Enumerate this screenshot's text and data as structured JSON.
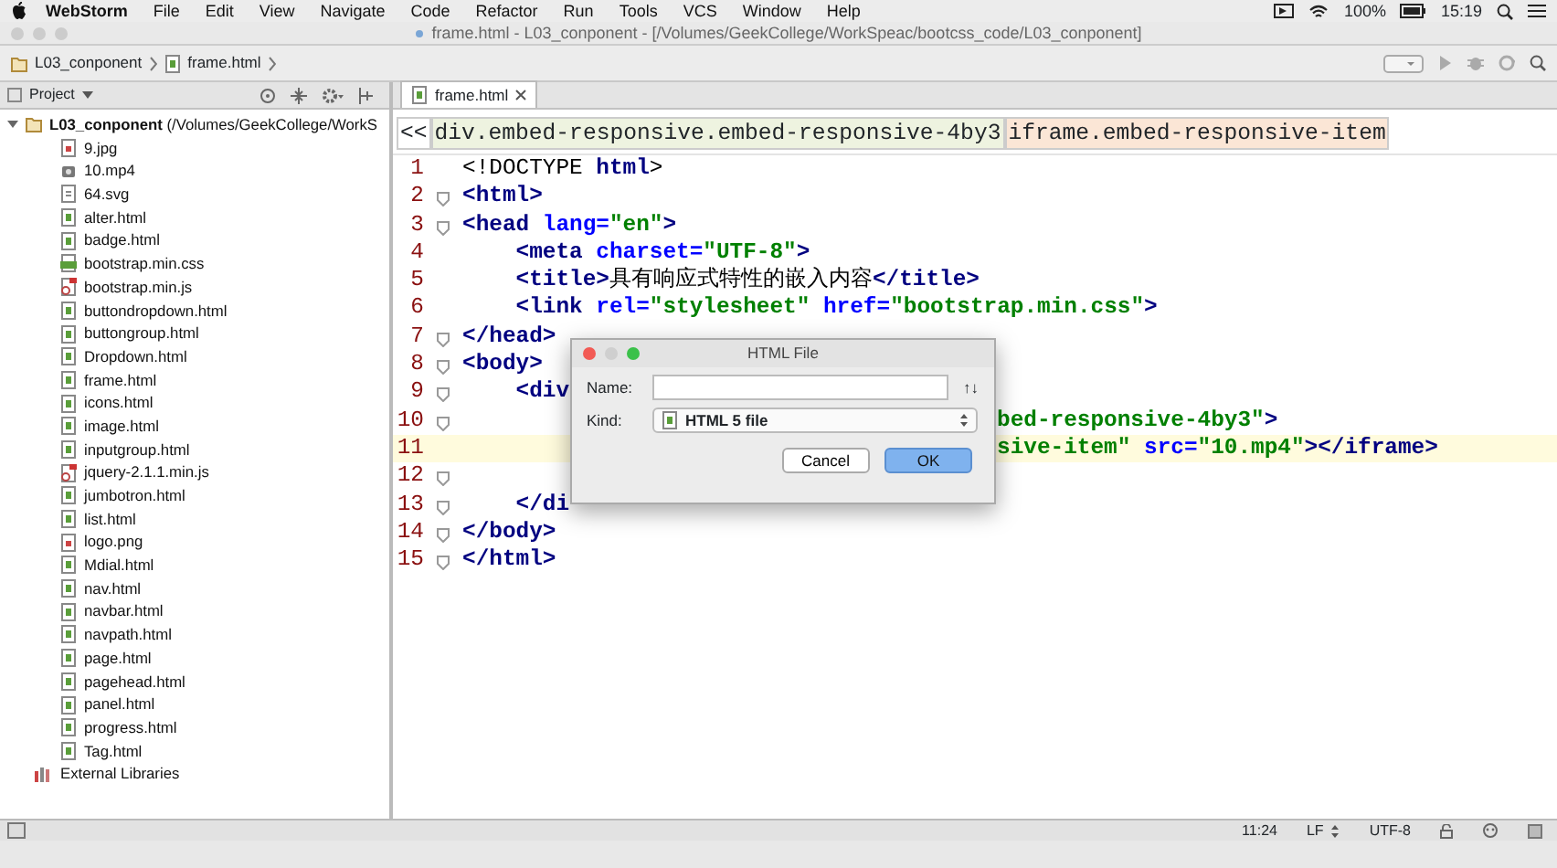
{
  "menu_bar": {
    "app": "WebStorm",
    "items": [
      "File",
      "Edit",
      "View",
      "Navigate",
      "Code",
      "Refactor",
      "Run",
      "Tools",
      "VCS",
      "Window",
      "Help"
    ],
    "battery": "100%",
    "clock": "15:19"
  },
  "window": {
    "title": "frame.html - L03_conponent - [/Volumes/GeekCollege/WorkSpeac/bootcss_code/L03_conponent]"
  },
  "nav_bar": {
    "crumbs": [
      {
        "label": "L03_conponent",
        "kind": "folder"
      },
      {
        "label": "frame.html",
        "kind": "html"
      }
    ]
  },
  "project_panel": {
    "title": "Project",
    "root": {
      "label": "L03_conponent",
      "path": "(/Volumes/GeekCollege/WorkS",
      "expanded": true,
      "children": [
        {
          "label": "9.jpg",
          "kind": "image"
        },
        {
          "label": "10.mp4",
          "kind": "video"
        },
        {
          "label": "64.svg",
          "kind": "text"
        },
        {
          "label": "alter.html",
          "kind": "html"
        },
        {
          "label": "badge.html",
          "kind": "html"
        },
        {
          "label": "bootstrap.min.css",
          "kind": "css"
        },
        {
          "label": "bootstrap.min.js",
          "kind": "js"
        },
        {
          "label": "buttondropdown.html",
          "kind": "html"
        },
        {
          "label": "buttongroup.html",
          "kind": "html"
        },
        {
          "label": "Dropdown.html",
          "kind": "html"
        },
        {
          "label": "frame.html",
          "kind": "html"
        },
        {
          "label": "icons.html",
          "kind": "html"
        },
        {
          "label": "image.html",
          "kind": "html"
        },
        {
          "label": "inputgroup.html",
          "kind": "html"
        },
        {
          "label": "jquery-2.1.1.min.js",
          "kind": "js"
        },
        {
          "label": "jumbotron.html",
          "kind": "html"
        },
        {
          "label": "list.html",
          "kind": "html"
        },
        {
          "label": "logo.png",
          "kind": "image"
        },
        {
          "label": "Mdial.html",
          "kind": "html"
        },
        {
          "label": "nav.html",
          "kind": "html"
        },
        {
          "label": "navbar.html",
          "kind": "html"
        },
        {
          "label": "navpath.html",
          "kind": "html"
        },
        {
          "label": "page.html",
          "kind": "html"
        },
        {
          "label": "pagehead.html",
          "kind": "html"
        },
        {
          "label": "panel.html",
          "kind": "html"
        },
        {
          "label": "progress.html",
          "kind": "html"
        },
        {
          "label": "Tag.html",
          "kind": "html"
        }
      ]
    },
    "extra": {
      "label": "External Libraries"
    }
  },
  "editor": {
    "tabs": [
      {
        "label": "frame.html",
        "selected": true
      }
    ],
    "breadcrumbs": {
      "back": "<<",
      "items": [
        {
          "label": "div.embed-responsive.embed-responsive-4by3",
          "color": "#eef3e0"
        },
        {
          "label": "iframe.embed-responsive-item",
          "color": "#fbe6d6"
        }
      ]
    },
    "lines": [
      {
        "number": "1",
        "fold": false,
        "current": false,
        "indented": false,
        "covered_start": false,
        "tokens": [
          {
            "kind": "text",
            "s": "<!DOCTYPE "
          },
          {
            "kind": "tag",
            "s": "html"
          },
          {
            "kind": "text",
            "s": ">"
          }
        ]
      },
      {
        "number": "2",
        "fold": true,
        "current": false,
        "indented": false,
        "covered_start": false,
        "tokens": [
          {
            "kind": "tag",
            "s": "<html>"
          }
        ]
      },
      {
        "number": "3",
        "fold": true,
        "current": false,
        "indented": false,
        "covered_start": false,
        "tokens": [
          {
            "kind": "tag",
            "s": "<head "
          },
          {
            "kind": "attr",
            "s": "lang="
          },
          {
            "kind": "value",
            "s": "\"en\""
          },
          {
            "kind": "tag",
            "s": ">"
          }
        ]
      },
      {
        "number": "4",
        "fold": false,
        "current": false,
        "indented": true,
        "covered_start": false,
        "tokens": [
          {
            "kind": "tag",
            "s": "<meta "
          },
          {
            "kind": "attr",
            "s": "charset="
          },
          {
            "kind": "value",
            "s": "\"UTF-8\""
          },
          {
            "kind": "tag",
            "s": ">"
          }
        ]
      },
      {
        "number": "5",
        "fold": false,
        "current": false,
        "indented": true,
        "covered_start": false,
        "tokens": [
          {
            "kind": "tag",
            "s": "<title>"
          },
          {
            "kind": "text",
            "s": "具有响应式特性的嵌入内容"
          },
          {
            "kind": "tag",
            "s": "</title>"
          }
        ]
      },
      {
        "number": "6",
        "fold": false,
        "current": false,
        "indented": true,
        "covered_start": false,
        "tokens": [
          {
            "kind": "tag",
            "s": "<link "
          },
          {
            "kind": "attr",
            "s": "rel="
          },
          {
            "kind": "value",
            "s": "\"stylesheet\" "
          },
          {
            "kind": "attr",
            "s": "href="
          },
          {
            "kind": "value",
            "s": "\"bootstrap.min.css\""
          },
          {
            "kind": "tag",
            "s": ">"
          }
        ]
      },
      {
        "number": "7",
        "fold": true,
        "current": false,
        "indented": false,
        "covered_start": false,
        "tokens": [
          {
            "kind": "tag",
            "s": "</head>"
          }
        ]
      },
      {
        "number": "8",
        "fold": true,
        "current": false,
        "indented": false,
        "covered_start": false,
        "tokens": [
          {
            "kind": "tag",
            "s": "<body>"
          }
        ]
      },
      {
        "number": "9",
        "fold": true,
        "current": false,
        "indented": true,
        "covered_start": false,
        "tokens": [
          {
            "kind": "tag",
            "s": "<div"
          }
        ]
      },
      {
        "number": "10",
        "fold": true,
        "current": false,
        "indented": false,
        "covered_start": true,
        "tokens": [
          {
            "kind": "value",
            "s": "bed-responsive-4by3\""
          },
          {
            "kind": "tag",
            "s": ">"
          }
        ]
      },
      {
        "number": "11",
        "fold": false,
        "current": true,
        "indented": false,
        "covered_start": true,
        "tokens": [
          {
            "kind": "value",
            "s": "sive-item\" "
          },
          {
            "kind": "attr",
            "s": "src="
          },
          {
            "kind": "value",
            "s": "\"10.mp4\""
          },
          {
            "kind": "tag",
            "s": "></iframe>"
          }
        ]
      },
      {
        "number": "12",
        "fold": true,
        "current": false,
        "indented": false,
        "covered_start": false
      },
      {
        "number": "13",
        "fold": true,
        "current": false,
        "indented": true,
        "covered_start": false,
        "tokens": [
          {
            "kind": "tag",
            "s": "</di"
          }
        ]
      },
      {
        "number": "14",
        "fold": true,
        "current": false,
        "indented": false,
        "covered_start": false,
        "tokens": [
          {
            "kind": "tag",
            "s": "</body>"
          }
        ]
      },
      {
        "number": "15",
        "fold": true,
        "current": false,
        "indented": false,
        "covered_start": false,
        "tokens": [
          {
            "kind": "tag",
            "s": "</html>"
          }
        ]
      }
    ]
  },
  "dialog": {
    "title": "HTML File",
    "name_label": "Name:",
    "sort_glyph": "↑↓",
    "kind_label": "Kind:",
    "kind_value": "HTML 5 file",
    "buttons": [
      {
        "label": "Cancel",
        "default": false
      },
      {
        "label": "OK",
        "default": true
      }
    ]
  },
  "status_bar": {
    "position": "11:24",
    "line_separator": "LF",
    "encoding": "UTF-8"
  }
}
